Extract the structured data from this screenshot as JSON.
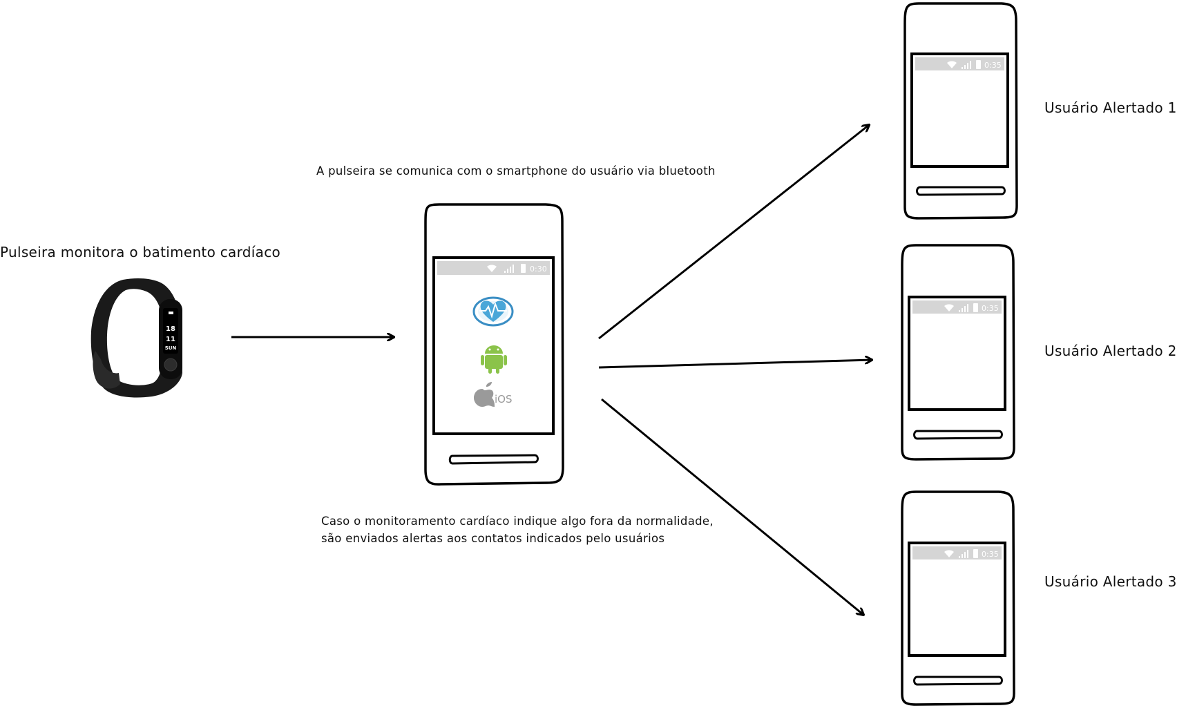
{
  "labels": {
    "wristband": "Pulseira monitora o batimento cardíaco",
    "bluetooth": "A pulseira se comunica com o smartphone do usuário via bluetooth",
    "alert_line1": "Caso o monitoramento cardíaco indique algo fora da normalidade,",
    "alert_line2": "são enviados alertas aos contatos indicados pelo usuários",
    "user1": "Usuário Alertado 1",
    "user2": "Usuário Alertado 2",
    "user3": "Usuário Alertado 3"
  },
  "main_phone": {
    "status_time": "0:30",
    "platforms": [
      "heart-app-icon",
      "android-icon",
      "ios-icon"
    ],
    "ios_label": "iOS"
  },
  "recipient_phones": [
    {
      "status_time": "0:35"
    },
    {
      "status_time": "0:35"
    },
    {
      "status_time": "0:35"
    }
  ],
  "wristband_display": {
    "line1": "18",
    "line2": "11",
    "line3": "SUN"
  }
}
